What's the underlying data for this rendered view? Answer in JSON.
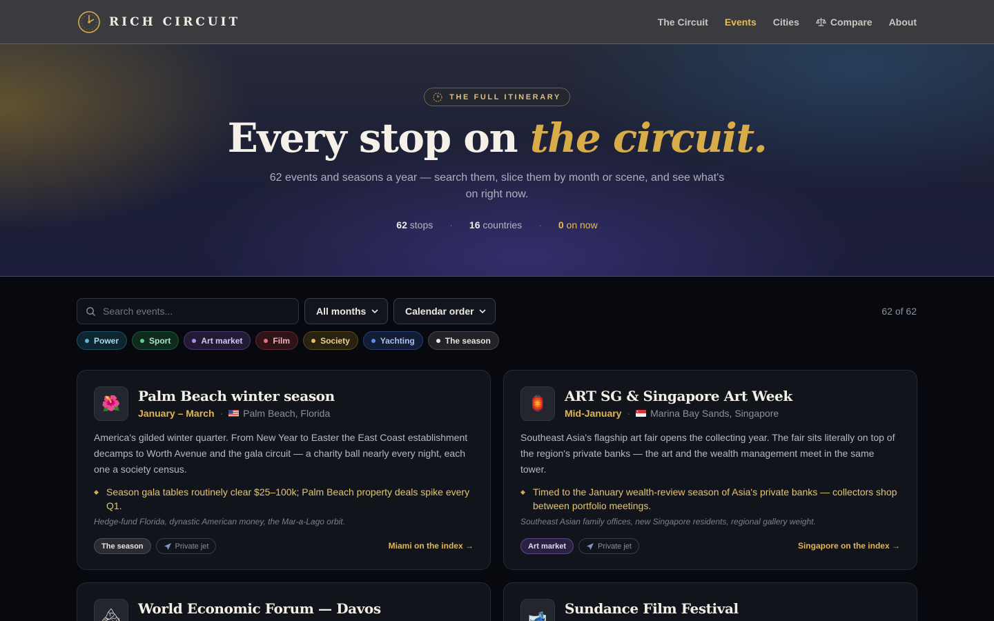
{
  "nav": {
    "brand": "RICH CIRCUIT",
    "links": [
      {
        "label": "The Circuit",
        "active": false
      },
      {
        "label": "Events",
        "active": true
      },
      {
        "label": "Cities",
        "active": false
      },
      {
        "label": "Compare",
        "active": false,
        "icon": "scales-icon"
      },
      {
        "label": "About",
        "active": false
      }
    ]
  },
  "hero": {
    "eyebrow": "THE FULL ITINERARY",
    "title_main": "Every stop on ",
    "title_accent": "the circuit.",
    "subtitle": "62 events and seasons a year — search them, slice them by month or scene, and see what's on right now.",
    "stats": [
      {
        "value": "62",
        "label": " stops"
      },
      {
        "value": "16",
        "label": " countries"
      },
      {
        "value": "0",
        "label": " on now"
      }
    ]
  },
  "controls": {
    "search_placeholder": "Search events...",
    "month_filter": "All months",
    "sort_order": "Calendar order",
    "result_count": "62 of 62"
  },
  "categories": [
    {
      "label": "Power",
      "color": "#5fb6d6",
      "bg": "#0e2630",
      "border": "#1f4f63",
      "text": "#a7dcef"
    },
    {
      "label": "Sport",
      "color": "#5fcf8e",
      "bg": "#0f2a1e",
      "border": "#22583c",
      "text": "#a9e6c3"
    },
    {
      "label": "Art market",
      "color": "#b48ce8",
      "bg": "#231b36",
      "border": "#4a3a72",
      "text": "#d5c4f2"
    },
    {
      "label": "Film",
      "color": "#ef6f7d",
      "bg": "#2e1419",
      "border": "#5e2a33",
      "text": "#f2b1b9"
    },
    {
      "label": "Society",
      "color": "#e7bd57",
      "bg": "#2a2210",
      "border": "#5a4a22",
      "text": "#ecd08e"
    },
    {
      "label": "Yachting",
      "color": "#5f8ee8",
      "bg": "#121d36",
      "border": "#2a3f70",
      "text": "#a9c2f2"
    },
    {
      "label": "The season",
      "color": "#e8e6e0",
      "bg": "#222328",
      "border": "#46474f",
      "text": "#e6e4de"
    }
  ],
  "events": [
    {
      "title": "Palm Beach winter season",
      "icon": "hibiscus-icon",
      "glyph": "🌺",
      "when": "January – March",
      "flag": "us",
      "where": "Palm Beach, Florida",
      "description": "America's gilded winter quarter. From New Year to Easter the East Coast establishment decamps to Worth Avenue and the gala circuit — a charity ball nearly every night, each one a society census.",
      "note": "Season gala tables routinely clear $25–100k; Palm Beach property deals spike every Q1.",
      "audience": "Hedge-fund Florida, dynastic American money, the Mar-a-Lago orbit.",
      "scene_tag": "The season",
      "travel_tag": "Private jet",
      "link": "Miami on the index"
    },
    {
      "title": "ART SG & Singapore Art Week",
      "icon": "lantern-icon",
      "glyph": "🏮",
      "when": "Mid-January",
      "flag": "sg",
      "where": "Marina Bay Sands, Singapore",
      "description": "Southeast Asia's flagship art fair opens the collecting year. The fair sits literally on top of the region's private banks — the art and the wealth management meet in the same tower.",
      "note": "Timed to the January wealth-review season of Asia's private banks — collectors shop between portfolio meetings.",
      "audience": "Southeast Asian family offices, new Singapore residents, regional gallery weight.",
      "scene_tag": "Art market",
      "travel_tag": "Private jet",
      "link": "Singapore on the index"
    },
    {
      "title": "World Economic Forum — Davos",
      "icon": "mountain-icon",
      "glyph": "🏔"
    },
    {
      "title": "Sundance Film Festival",
      "icon": "ski-icon",
      "glyph": "🎿"
    }
  ]
}
